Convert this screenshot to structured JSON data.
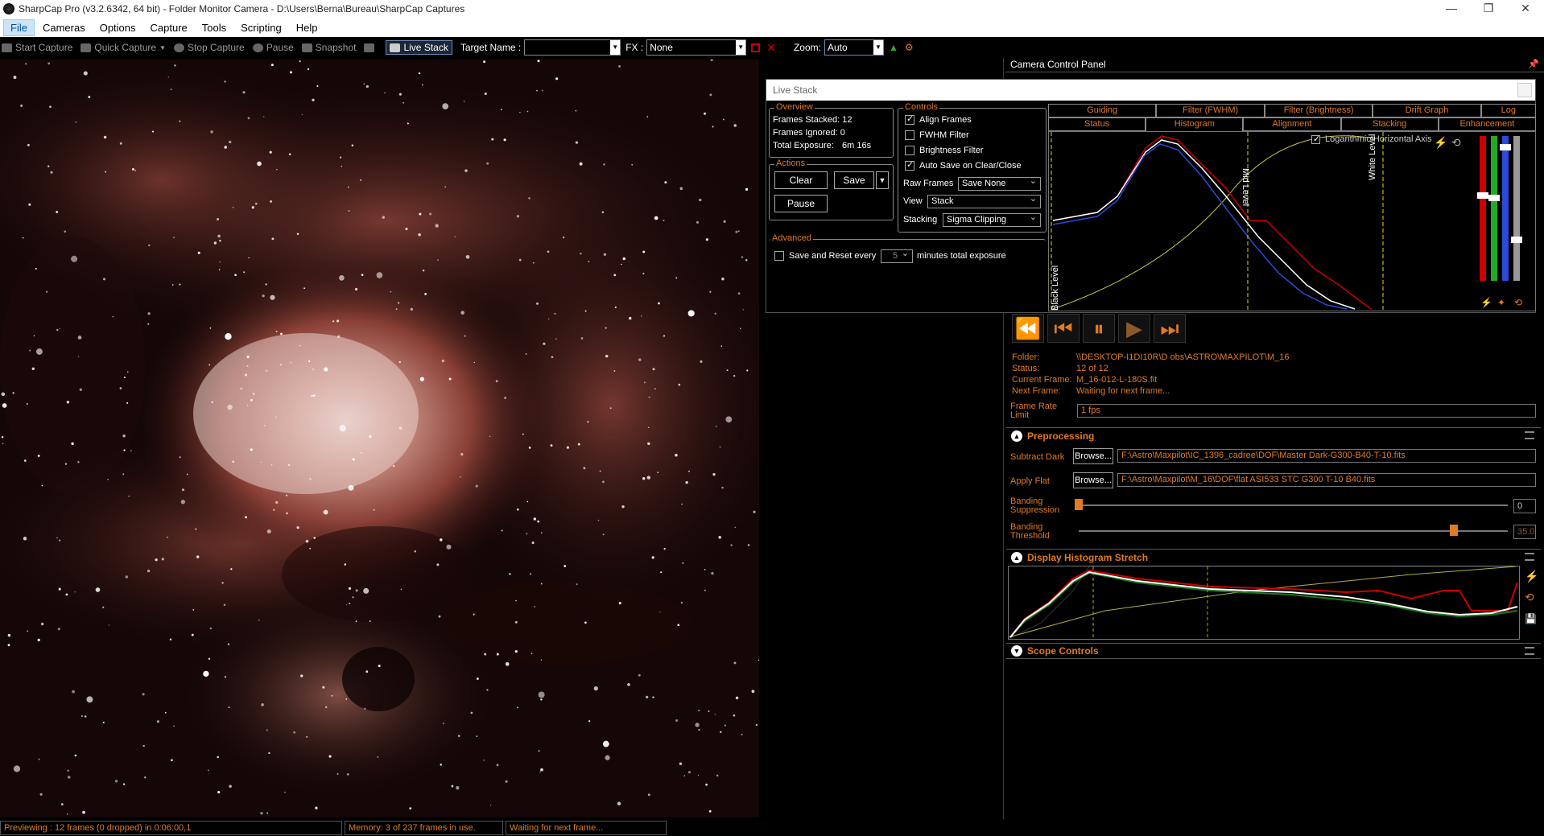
{
  "window": {
    "title": "SharpCap Pro (v3.2.6342, 64 bit) - Folder Monitor Camera - D:\\Users\\Berna\\Bureau\\SharpCap Captures"
  },
  "menu": [
    "File",
    "Cameras",
    "Options",
    "Capture",
    "Tools",
    "Scripting",
    "Help"
  ],
  "toolbar": {
    "start_capture": "Start Capture",
    "quick_capture": "Quick Capture",
    "stop_capture": "Stop Capture",
    "pause": "Pause",
    "snapshot": "Snapshot",
    "live_stack": "Live Stack",
    "target_name_label": "Target Name :",
    "target_name_value": "",
    "fx_label": "FX :",
    "fx_value": "None",
    "zoom_label": "Zoom:",
    "zoom_value": "Auto"
  },
  "camera_control_panel": {
    "title": "Camera Control Panel"
  },
  "live_stack": {
    "title": "Live Stack",
    "overview": {
      "title": "Overview",
      "frames_stacked": "Frames Stacked: 12",
      "frames_ignored": "Frames Ignored:  0",
      "total_exposure_label": "Total Exposure:",
      "total_exposure_value": "6m 16s"
    },
    "actions": {
      "title": "Actions",
      "clear": "Clear",
      "save": "Save",
      "pause": "Pause"
    },
    "advanced": {
      "title": "Advanced",
      "save_reset_label": "Save and Reset every",
      "minutes_value": "5",
      "minutes_suffix": "minutes total exposure"
    },
    "controls": {
      "title": "Controls",
      "align_frames": "Align Frames",
      "fwhm_filter": "FWHM Filter",
      "brightness_filter": "Brightness Filter",
      "auto_save": "Auto Save on Clear/Close",
      "raw_frames_label": "Raw Frames",
      "raw_frames_value": "Save None",
      "view_label": "View",
      "view_value": "Stack",
      "stacking_label": "Stacking",
      "stacking_value": "Sigma Clipping"
    },
    "tabs_row1": [
      "Guiding",
      "Filter (FWHM)",
      "Filter (Brightness)",
      "Drift Graph",
      "Log"
    ],
    "tabs_row2": [
      "Status",
      "Histogram",
      "Alignment",
      "Stacking",
      "Enhancement"
    ],
    "histogram": {
      "log_axis_label": "Logarithmic Horizontal Axis",
      "black_level": "Black Level",
      "mid_level": "Mid Level",
      "white_level": "White Level"
    }
  },
  "folder_monitor": {
    "folder_label": "Folder:",
    "folder_value": "\\\\DESKTOP-I1DI10R\\D obs\\ASTRO\\MAXPILOT\\M_16",
    "status_label": "Status:",
    "status_value": "12 of 12",
    "current_frame_label": "Current Frame:",
    "current_frame_value": "M_16-012-L-180S.fit",
    "next_frame_label": "Next Frame:",
    "next_frame_value": "Waiting for next frame...",
    "frame_rate_label_1": "Frame Rate",
    "frame_rate_label_2": "Limit",
    "frame_rate_value": "1 fps"
  },
  "preprocessing": {
    "title": "Preprocessing",
    "subtract_dark_label": "Subtract Dark",
    "browse": "Browse...",
    "dark_path": "F:\\Astro\\Maxpilot\\IC_1396_cadree\\DOF\\Master Dark-G300-B40-T-10.fits",
    "apply_flat_label": "Apply Flat",
    "flat_path": "F:\\Astro\\Maxpilot\\M_16\\DOF\\flat ASI533 STC G300 T-10 B40.fits",
    "banding_suppression_1": "Banding",
    "banding_suppression_2": "Suppression",
    "banding_suppression_value": "0",
    "banding_suppression_level": 0.0,
    "banding_threshold_1": "Banding",
    "banding_threshold_2": "Threshold",
    "banding_threshold_value": "35.0",
    "banding_threshold_level": 0.875
  },
  "display_histogram": {
    "title": "Display Histogram Stretch"
  },
  "scope_controls": {
    "title": "Scope Controls"
  },
  "statusbar": {
    "previewing": "Previewing : 12 frames (0 dropped) in 0:06:00,1",
    "memory": "Memory: 3 of 237 frames in use.",
    "waiting": "Waiting for next frame..."
  },
  "colors": {
    "accent": "#e07a23",
    "bg": "#000000",
    "nebula": "#b9695a"
  }
}
